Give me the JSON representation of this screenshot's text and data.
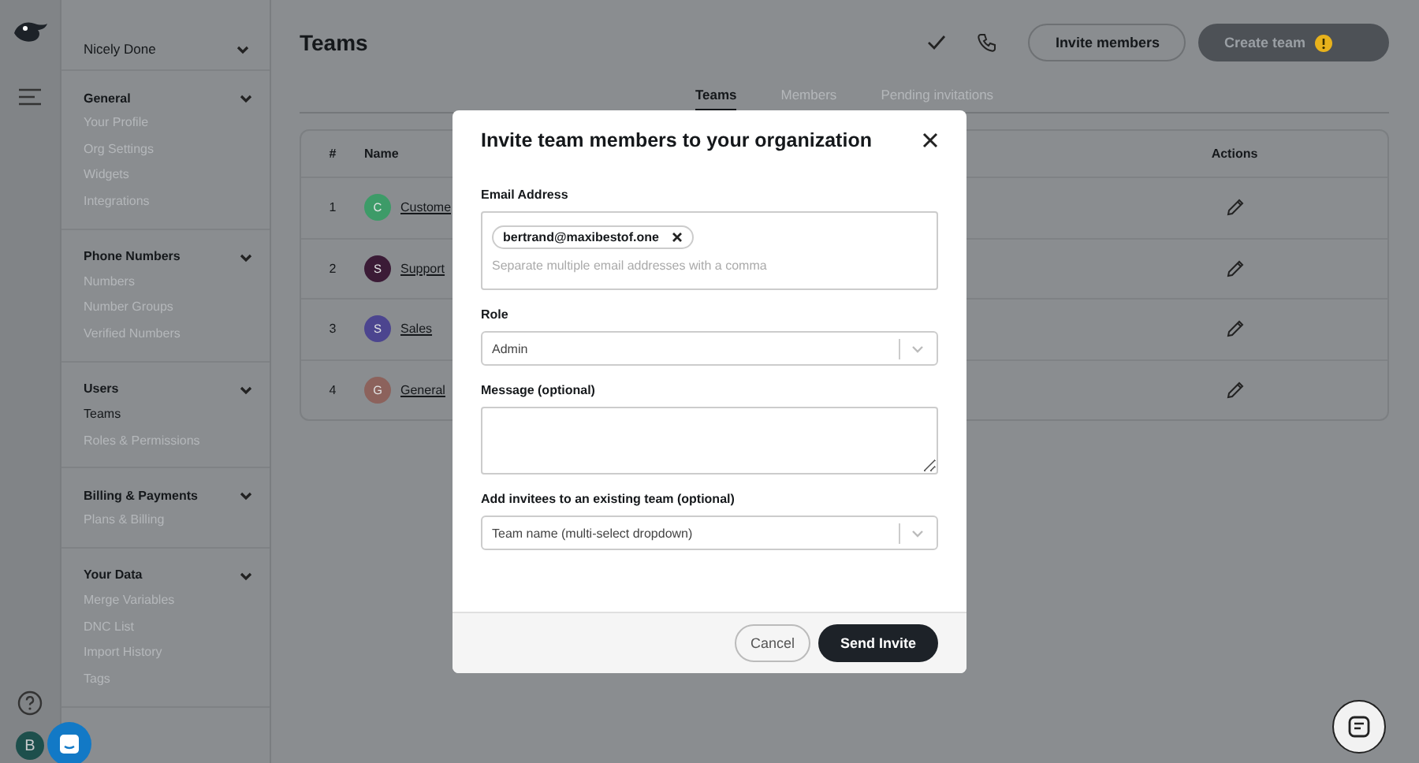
{
  "rail": {
    "avatar": "B"
  },
  "sidebar": {
    "workspace": "Nicely Done",
    "sections": [
      {
        "title": "General",
        "expanded": true,
        "items": [
          {
            "label": "Your Profile",
            "selected": false
          },
          {
            "label": "Org Settings",
            "selected": false
          },
          {
            "label": "Widgets",
            "selected": false
          },
          {
            "label": "Integrations",
            "selected": false
          }
        ]
      },
      {
        "title": "Phone Numbers",
        "expanded": true,
        "items": [
          {
            "label": "Numbers",
            "selected": false
          },
          {
            "label": "Number Groups",
            "selected": false
          },
          {
            "label": "Verified Numbers",
            "selected": false
          }
        ]
      },
      {
        "title": "Users",
        "expanded": true,
        "items": [
          {
            "label": "Teams",
            "selected": true
          },
          {
            "label": "Roles & Permissions",
            "selected": false
          }
        ]
      },
      {
        "title": "Billing & Payments",
        "expanded": true,
        "items": [
          {
            "label": "Plans & Billing",
            "selected": false
          }
        ]
      },
      {
        "title": "Your Data",
        "expanded": true,
        "items": [
          {
            "label": "Merge Variables",
            "selected": false
          },
          {
            "label": "DNC List",
            "selected": false
          },
          {
            "label": "Import History",
            "selected": false
          },
          {
            "label": "Tags",
            "selected": false
          }
        ]
      }
    ]
  },
  "page": {
    "title": "Teams",
    "invite_button": "Invite members",
    "create_button": {
      "label": "Create team",
      "disabled": true
    }
  },
  "tabs": [
    {
      "label": "Teams",
      "selected": true
    },
    {
      "label": "Members",
      "selected": false
    },
    {
      "label": "Pending invitations",
      "selected": false
    }
  ],
  "table": {
    "columns": [
      "#",
      "Name",
      "Actions"
    ],
    "rows": [
      {
        "number": "1",
        "initial": "C",
        "color": "#3d9b68",
        "name": "Custome"
      },
      {
        "number": "2",
        "initial": "S",
        "color": "#3b1b36",
        "name": "Support"
      },
      {
        "number": "3",
        "initial": "S",
        "color": "#4c458f",
        "name": "Sales"
      },
      {
        "number": "4",
        "initial": "G",
        "color": "#8c625c",
        "name": "General"
      }
    ]
  },
  "modal": {
    "title": "Invite team members to your organization",
    "email": {
      "label": "Email Address",
      "chips": [
        "bertrand@maxibestof.one"
      ],
      "placeholder": "Separate multiple email addresses with a comma"
    },
    "role": {
      "label": "Role",
      "value": "Admin"
    },
    "message": {
      "label": "Message (optional)"
    },
    "team": {
      "label": "Add invitees to an existing team (optional)",
      "placeholder": "Team name (multi-select dropdown)"
    },
    "cancel": "Cancel",
    "send": "Send Invite"
  }
}
